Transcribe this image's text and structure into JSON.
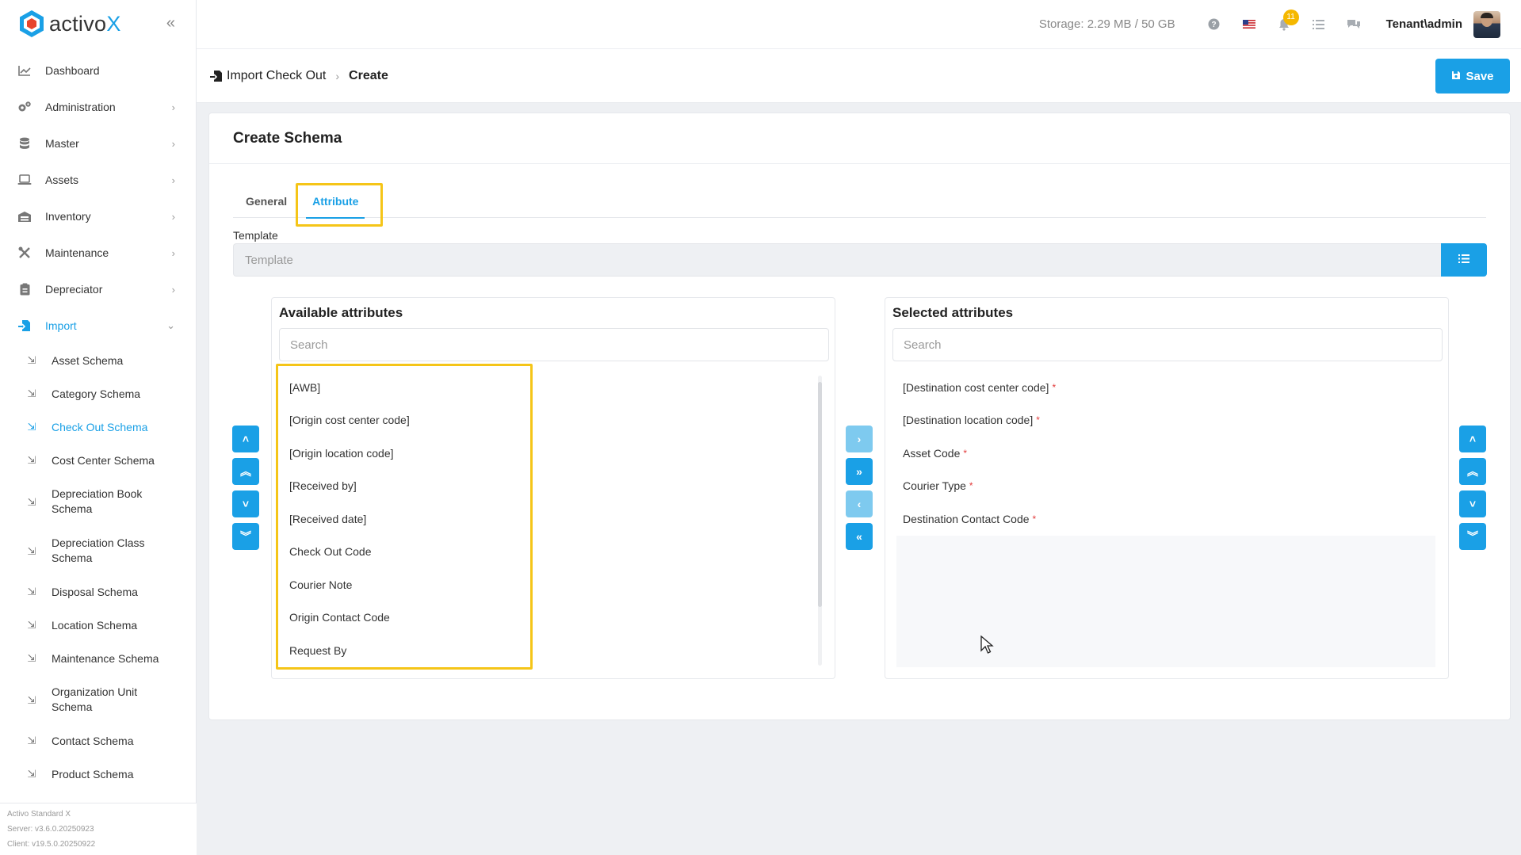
{
  "app": {
    "logo_text_main": "activo",
    "logo_text_accent": "X",
    "footer": {
      "line1": "Activo Standard X",
      "line2": "Server: v3.6.0.20250923",
      "line3": "Client: v19.5.0.20250922"
    }
  },
  "sidebar": {
    "items": [
      {
        "label": "Dashboard",
        "icon": "chart-icon"
      },
      {
        "label": "Administration",
        "icon": "gears-icon"
      },
      {
        "label": "Master",
        "icon": "database-icon"
      },
      {
        "label": "Assets",
        "icon": "laptop-icon"
      },
      {
        "label": "Inventory",
        "icon": "warehouse-icon"
      },
      {
        "label": "Maintenance",
        "icon": "tools-icon"
      },
      {
        "label": "Depreciator",
        "icon": "clipboard-icon"
      },
      {
        "label": "Import",
        "icon": "import-icon"
      }
    ],
    "import_sub": [
      "Asset Schema",
      "Category Schema",
      "Check Out Schema",
      "Cost Center Schema",
      "Depreciation Book Schema",
      "Depreciation Class Schema",
      "Disposal Schema",
      "Location Schema",
      "Maintenance Schema",
      "Organization Unit Schema",
      "Contact Schema",
      "Product Schema"
    ]
  },
  "topbar": {
    "storage": "Storage: 2.29 MB / 50 GB",
    "notification_count": "11",
    "user": "Tenant\\admin"
  },
  "breadcrumb": {
    "parent": "Import Check Out",
    "current": "Create"
  },
  "toolbar": {
    "save_label": "Save"
  },
  "card": {
    "title": "Create Schema",
    "tabs": [
      "General",
      "Attribute"
    ],
    "active_tab": "Attribute",
    "template_label": "Template",
    "template_placeholder": "Template"
  },
  "available": {
    "title": "Available attributes",
    "search_placeholder": "Search",
    "items": [
      "[AWB]",
      "[Origin cost center code]",
      "[Origin location code]",
      "[Received by]",
      "[Received date]",
      "Check Out Code",
      "Courier Note",
      "Origin Contact Code",
      "Request By"
    ]
  },
  "selected": {
    "title": "Selected attributes",
    "search_placeholder": "Search",
    "required_mark": "*",
    "items": [
      "[Destination cost center code]",
      "[Destination location code]",
      "Asset Code",
      "Courier Type",
      "Destination Contact Code"
    ]
  },
  "colors": {
    "accent": "#1aa0e6",
    "highlight": "#f5c518",
    "required": "#e23b3b"
  }
}
